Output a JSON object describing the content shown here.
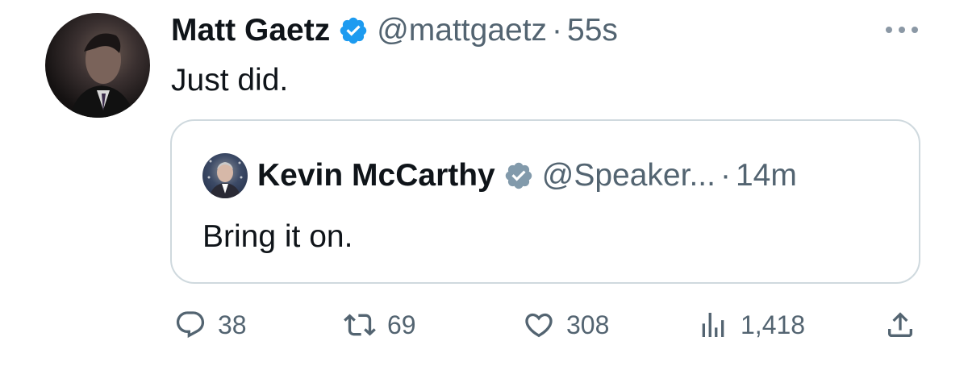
{
  "tweet": {
    "author_name": "Matt Gaetz",
    "author_handle": "@mattgaetz",
    "separator": "·",
    "time": "55s",
    "text": "Just did.",
    "verified_color": "#1d9bf0"
  },
  "quoted_tweet": {
    "author_name": "Kevin McCarthy",
    "author_handle": "@Speaker...",
    "separator": "·",
    "time": "14m",
    "text": "Bring it on.",
    "verified_color": "#829aab"
  },
  "actions": {
    "replies": "38",
    "retweets": "69",
    "likes": "308",
    "views": "1,418"
  },
  "icons": {
    "more": "more-dots-icon",
    "reply": "reply-bubble-icon",
    "retweet": "retweet-arrows-icon",
    "like": "heart-icon",
    "views": "bar-chart-icon",
    "share": "share-upload-icon"
  },
  "colors": {
    "text_primary": "#0f1419",
    "text_secondary": "#536471",
    "border": "#cfd9de"
  }
}
